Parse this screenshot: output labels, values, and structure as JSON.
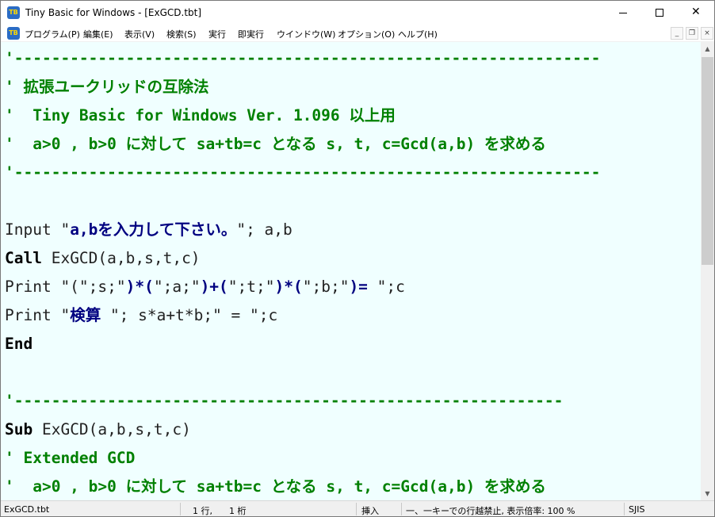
{
  "window": {
    "title": "Tiny Basic for Windows - [ExGCD.tbt]",
    "icon_label": "TB",
    "minimize_label": "",
    "close_label": "✕"
  },
  "menu": {
    "items": [
      "プログラム(P)",
      "編集(E)",
      "表示(V)",
      "検索(S)",
      "実行",
      "即実行",
      "ウインドウ(W)",
      "オプション(O)",
      "ヘルプ(H)"
    ],
    "mdi_minimize": "_",
    "mdi_restore": "❐",
    "mdi_close": "×"
  },
  "editor": {
    "background": "#f0ffff",
    "comment_color": "#008000",
    "string_color": "#000080",
    "lines": {
      "l1": "'---------------------------------------------------------------",
      "l2": "' 拡張ユークリッドの互除法",
      "l3": "'  Tiny Basic for Windows Ver. 1.096 以上用",
      "l4": "'  a>0 , b>0 に対して sa+tb=c となる s, t, c=Gcd(a,b) を求める",
      "l5": "'---------------------------------------------------------------",
      "l7a": "Input \"",
      "l7b": "a,bを入力して下さい。",
      "l7c": "\"; a,b",
      "l8a": "Call",
      "l8b": " ExGCD(a,b,s,t,c)",
      "l9a": "Print \"(\";s;\"",
      "l9b": ")*(",
      "l9c": "\";a;\"",
      "l9d": ")+(",
      "l9e": "\";t;\"",
      "l9f": ")*(",
      "l9g": "\";b;\"",
      "l9h": ")= ",
      "l9i": "\";c",
      "l10a": "Print \"",
      "l10b": "検算 ",
      "l10c": "\"; s*a+t*b;\" = \";c",
      "l11": "End",
      "l13": "'-----------------------------------------------------------",
      "l14a": "Sub",
      "l14b": " ExGCD(a,b,s,t,c)",
      "l15": "' Extended GCD",
      "l16": "'  a>0 , b>0 に対して sa+tb=c となる s, t, c=Gcd(a,b) を求める"
    }
  },
  "scrollbar": {
    "up_arrow": "▲",
    "down_arrow": "▼"
  },
  "status": {
    "file": "ExGCD.tbt",
    "row": "1 行,",
    "col": "1 桁",
    "mode": "挿入",
    "info": "一、一キーでの行越禁止, 表示倍率:  100 %",
    "encoding": "SJIS"
  }
}
